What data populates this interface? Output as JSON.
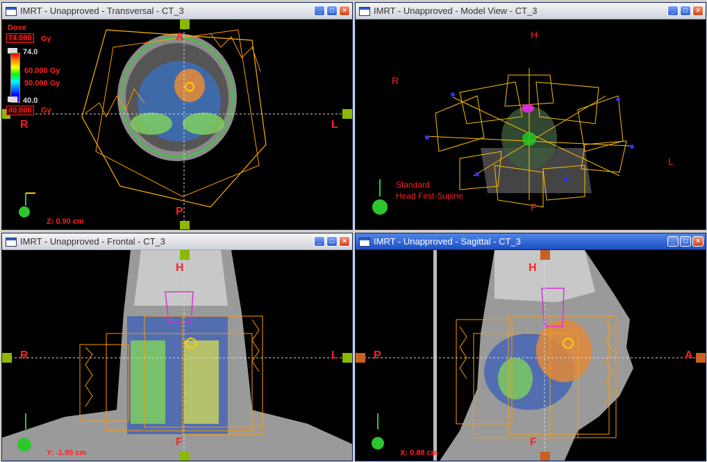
{
  "windows": {
    "transversal": {
      "title": "IMRT  -  Unapproved - Transversal - CT_3",
      "labels": {
        "ant": "A",
        "post": "P",
        "right": "R",
        "left": "L"
      },
      "dose": {
        "heading": "Dose",
        "max_value": "74.000",
        "unit": "Gy",
        "top_marker": "74.0",
        "level1": "60.000 Gy",
        "level2": "50.000 Gy",
        "bottom_marker": "40.0",
        "min_value": "40.000",
        "min_unit": "Gy"
      },
      "coord": "Z: 0.90 cm"
    },
    "model": {
      "title": "IMRT  -  Unapproved  -  Model View - CT_3",
      "labels": {
        "head": "H",
        "feet": "F",
        "right": "R",
        "left": "L"
      },
      "orientation": [
        "Standard",
        "Head First-Supine"
      ]
    },
    "frontal": {
      "title": "IMRT  -  Unapproved - Frontal - CT_3",
      "labels": {
        "head": "H",
        "feet": "F",
        "right": "R",
        "left": "L"
      },
      "coord": "Y: -1.95 cm"
    },
    "sagittal": {
      "title": "IMRT  -  Unapproved - Sagittal - CT_3",
      "labels": {
        "head": "H",
        "feet": "F",
        "post": "P",
        "ant": "A"
      },
      "coord": "X: 0.88 cm"
    }
  },
  "window_buttons": {
    "minimize": "_",
    "restore": "□",
    "close": "×"
  },
  "colors": {
    "label": "#ff2020",
    "beam": "#ffb400",
    "contour_green": "#22dd22",
    "titlebar_active": "#2a5cd0"
  }
}
